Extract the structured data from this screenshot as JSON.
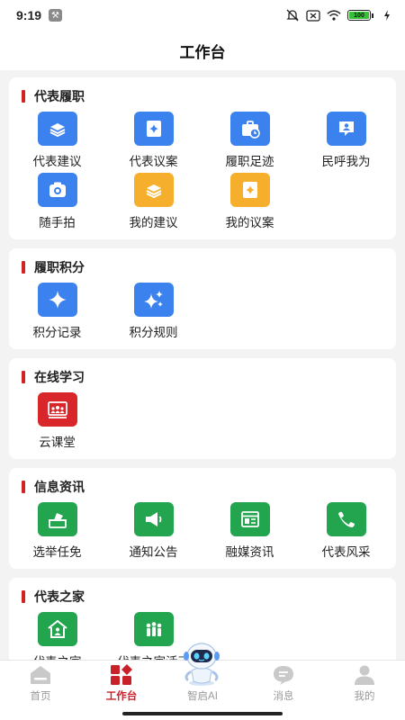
{
  "status": {
    "time": "9:19",
    "battery": "100"
  },
  "header": {
    "title": "工作台"
  },
  "sections": [
    {
      "title": "代表履职",
      "items": [
        {
          "label": "代表建议",
          "color": "#3b82ee",
          "icon": "book-stack-icon"
        },
        {
          "label": "代表议案",
          "color": "#3b82ee",
          "icon": "sparkle-doc-icon"
        },
        {
          "label": "履职足迹",
          "color": "#3b82ee",
          "icon": "briefcase-clock-icon"
        },
        {
          "label": "民呼我为",
          "color": "#3b82ee",
          "icon": "person-chat-icon"
        },
        {
          "label": "随手拍",
          "color": "#3b82ee",
          "icon": "camera-icon"
        },
        {
          "label": "我的建议",
          "color": "#f6ae2d",
          "icon": "book-stack-icon"
        },
        {
          "label": "我的议案",
          "color": "#f6ae2d",
          "icon": "sparkle-doc-icon"
        }
      ]
    },
    {
      "title": "履职积分",
      "items": [
        {
          "label": "积分记录",
          "color": "#3b82ee",
          "icon": "star-sparkle-icon"
        },
        {
          "label": "积分规则",
          "color": "#3b82ee",
          "icon": "multi-sparkle-icon"
        }
      ]
    },
    {
      "title": "在线学习",
      "items": [
        {
          "label": "云课堂",
          "color": "#d9262a",
          "icon": "classroom-icon"
        }
      ]
    },
    {
      "title": "信息资讯",
      "items": [
        {
          "label": "选举任免",
          "color": "#23a44e",
          "icon": "ballot-box-icon"
        },
        {
          "label": "通知公告",
          "color": "#23a44e",
          "icon": "megaphone-icon"
        },
        {
          "label": "融媒资讯",
          "color": "#23a44e",
          "icon": "newspaper-icon"
        },
        {
          "label": "代表风采",
          "color": "#23a44e",
          "icon": "handshake-icon"
        }
      ]
    },
    {
      "title": "代表之家",
      "items": [
        {
          "label": "代表之家",
          "color": "#23a44e",
          "icon": "house-icon"
        },
        {
          "label": "代表之家活动",
          "color": "#23a44e",
          "icon": "people-group-icon"
        }
      ]
    }
  ],
  "tabbar": [
    {
      "label": "首页",
      "icon": "home-icon",
      "active": false
    },
    {
      "label": "工作台",
      "icon": "workbench-icon",
      "active": true
    },
    {
      "label": "智启AI",
      "icon": "robot-icon",
      "active": false
    },
    {
      "label": "消息",
      "icon": "message-icon",
      "active": false
    },
    {
      "label": "我的",
      "icon": "profile-icon",
      "active": false
    }
  ],
  "colors": {
    "accent_red": "#c8212a",
    "blue": "#3b82ee",
    "orange": "#f6ae2d",
    "green": "#23a44e"
  }
}
